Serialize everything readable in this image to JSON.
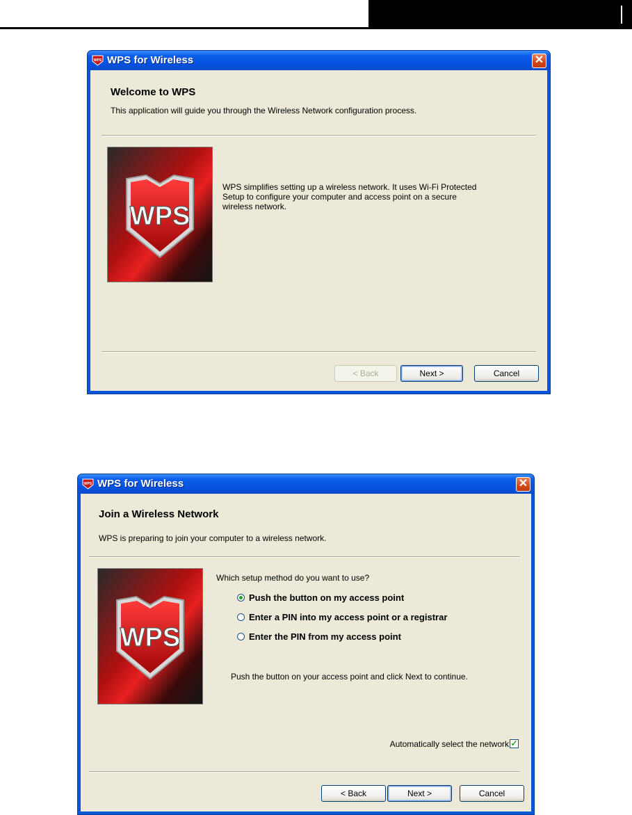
{
  "dialog1": {
    "title": "WPS for Wireless",
    "header_title": "Welcome to WPS",
    "header_subtitle": "This application will guide you through the Wireless Network configuration process.",
    "description_lines": [
      "WPS simplifies setting up a wireless network. It uses Wi-Fi Protected",
      "Setup to configure your computer and access point on a secure",
      "wireless network."
    ],
    "logo_text": "WPS",
    "buttons": {
      "back": "< Back",
      "next": "Next >",
      "cancel": "Cancel"
    },
    "back_enabled": false
  },
  "dialog2": {
    "title": "WPS for Wireless",
    "header_title": "Join a Wireless Network",
    "header_subtitle": "WPS is preparing to join your computer to a wireless network.",
    "question": "Which setup method do you want to use?",
    "options": [
      {
        "label": "Push the button on my access point",
        "selected": true
      },
      {
        "label": "Enter a PIN into my access point or a registrar",
        "selected": false
      },
      {
        "label": "Enter the PIN from my access point",
        "selected": false
      }
    ],
    "instruction": "Push the button on your access point and click Next to continue.",
    "auto_select_label": "Automatically select the network",
    "auto_select_checked": true,
    "logo_text": "WPS",
    "buttons": {
      "back": "< Back",
      "next": "Next >",
      "cancel": "Cancel"
    }
  },
  "colors": {
    "titlebar": "#0551e0",
    "dialog_bg": "#ece9d8",
    "close": "#d4481a",
    "accent_red": "#c41a1a"
  }
}
